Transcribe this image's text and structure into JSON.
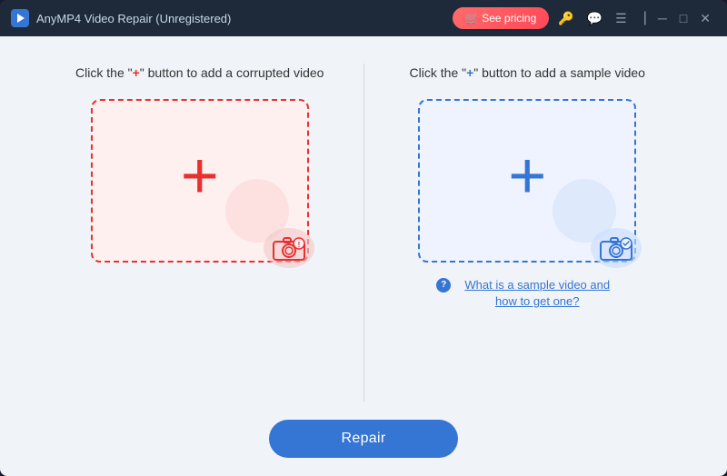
{
  "window": {
    "title": "AnyMP4 Video Repair (Unregistered)",
    "logo_symbol": "▶"
  },
  "title_bar": {
    "see_pricing_label": "🛒 See pricing",
    "key_icon": "🔑",
    "chat_icon": "💬",
    "menu_icon": "☰",
    "minimize": "─",
    "maximize": "□",
    "close": "✕"
  },
  "left_panel": {
    "instruction_prefix": "Click the \"",
    "instruction_plus": "+",
    "instruction_suffix": "\" button to add a corrupted video",
    "plus_symbol": "+"
  },
  "right_panel": {
    "instruction_prefix": "Click the \"",
    "instruction_plus": "+",
    "instruction_suffix": "\" button to add a sample video",
    "plus_symbol": "+",
    "sample_link_text": "What is a sample video and how to get one?"
  },
  "footer": {
    "repair_label": "Repair"
  },
  "colors": {
    "red_accent": "#e83030",
    "blue_accent": "#3575d4",
    "bg_main": "#f0f4f8",
    "title_bar_bg": "#1e2a3a"
  }
}
